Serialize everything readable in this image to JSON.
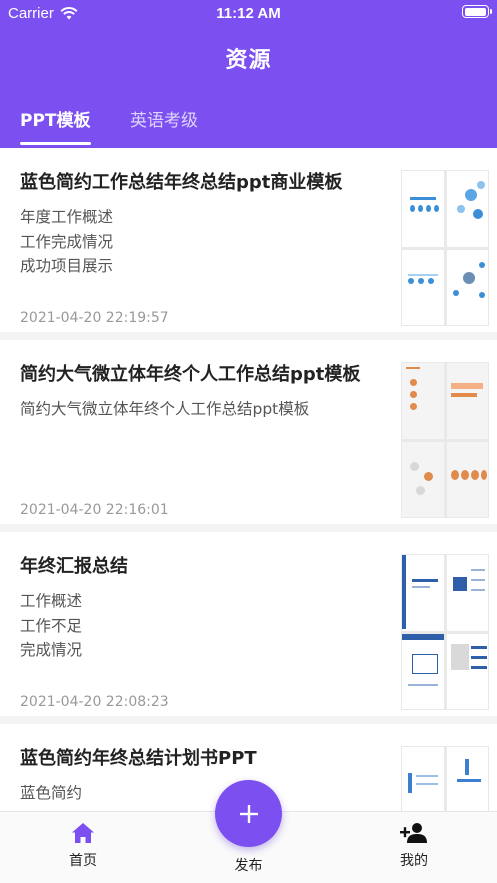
{
  "status_bar": {
    "carrier": "Carrier",
    "time": "11:12 AM",
    "battery_level": 1.0
  },
  "header": {
    "title": "资源"
  },
  "tabs": [
    {
      "label": "PPT模板",
      "active": true
    },
    {
      "label": "英语考级",
      "active": false
    }
  ],
  "items": [
    {
      "title": "蓝色简约工作总结年终总结ppt商业模板",
      "desc": [
        "年度工作概述",
        "工作完成情况",
        "成功项目展示"
      ],
      "date": "2021-04-20 22:19:57",
      "thumb_theme": "blue"
    },
    {
      "title": "简约大气微立体年终个人工作总结ppt模板",
      "desc": [
        "简约大气微立体年终个人工作总结ppt模板"
      ],
      "date": "2021-04-20 22:16:01",
      "thumb_theme": "orange"
    },
    {
      "title": "年终汇报总结",
      "desc": [
        "工作概述",
        "工作不足",
        "完成情况"
      ],
      "date": "2021-04-20 22:08:23",
      "thumb_theme": "navy"
    },
    {
      "title": "蓝色简约年终总结计划书PPT",
      "desc": [
        "蓝色简约"
      ],
      "date": "",
      "thumb_theme": "lightblue"
    }
  ],
  "bottom_nav": {
    "home": {
      "label": "首页",
      "icon": "home-icon"
    },
    "publish": {
      "label": "发布",
      "icon": "plus-icon"
    },
    "mine": {
      "label": "我的",
      "icon": "add-user-icon"
    }
  },
  "colors": {
    "primary": "#7b4ff0",
    "text": "#222222",
    "muted": "#999999"
  }
}
